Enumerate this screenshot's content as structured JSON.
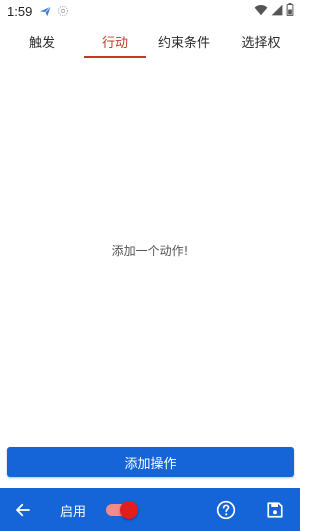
{
  "status_bar": {
    "time": "1:59",
    "left_icons": [
      "paper-plane-icon",
      "notification-outline-icon"
    ],
    "right_icons": [
      "wifi-icon",
      "cellular-signal-icon",
      "battery-icon"
    ]
  },
  "tabs": [
    {
      "label": "触发",
      "active": false
    },
    {
      "label": "行动",
      "active": true
    },
    {
      "label": "约束条件",
      "active": false
    },
    {
      "label": "选择权",
      "active": false
    }
  ],
  "empty_state": {
    "message": "添加一个动作!"
  },
  "add_button": {
    "label": "添加操作"
  },
  "bottom_bar": {
    "back_icon": "arrow-left-icon",
    "enable_label": "启用",
    "toggle_on": true,
    "help_icon": "help-circle-icon",
    "save_icon": "floppy-disk-icon"
  },
  "colors": {
    "accent_red": "#c0392b",
    "primary_blue": "#1565d8",
    "toggle_thumb": "#e11d1d",
    "toggle_track": "#f28b8b"
  }
}
